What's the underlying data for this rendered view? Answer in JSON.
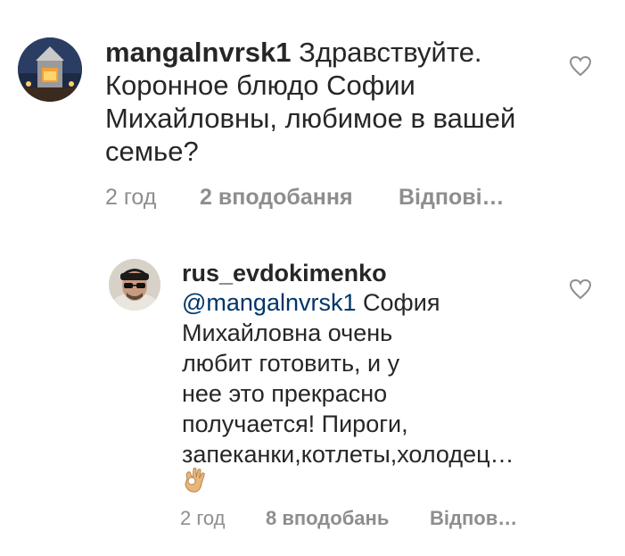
{
  "comments": [
    {
      "username": "mangalnvrsk1",
      "text_lines": [
        "Здравствуйте.",
        "Коронное блюдо Софии",
        "Михайловны, любимое в вашей",
        "семье?"
      ],
      "time": "2 год",
      "likes": "2 вподобання",
      "reply": "Відпові…"
    },
    {
      "username": "rus_evdokimenko",
      "mention": "@mangalnvrsk1",
      "text_lines": [
        "София",
        "Михайловна очень",
        "любит готовить, и у",
        "нее это прекрасно",
        "получается! Пироги,",
        "запеканки,котлеты,холодец…"
      ],
      "emoji": "ok-hand",
      "time": "2 год",
      "likes": "8 вподобань",
      "reply": "Відпов…"
    }
  ],
  "icons": {
    "like": "heart-outline-icon"
  },
  "colors": {
    "text": "#262626",
    "meta": "#8e8e8e",
    "mention": "#003569"
  }
}
